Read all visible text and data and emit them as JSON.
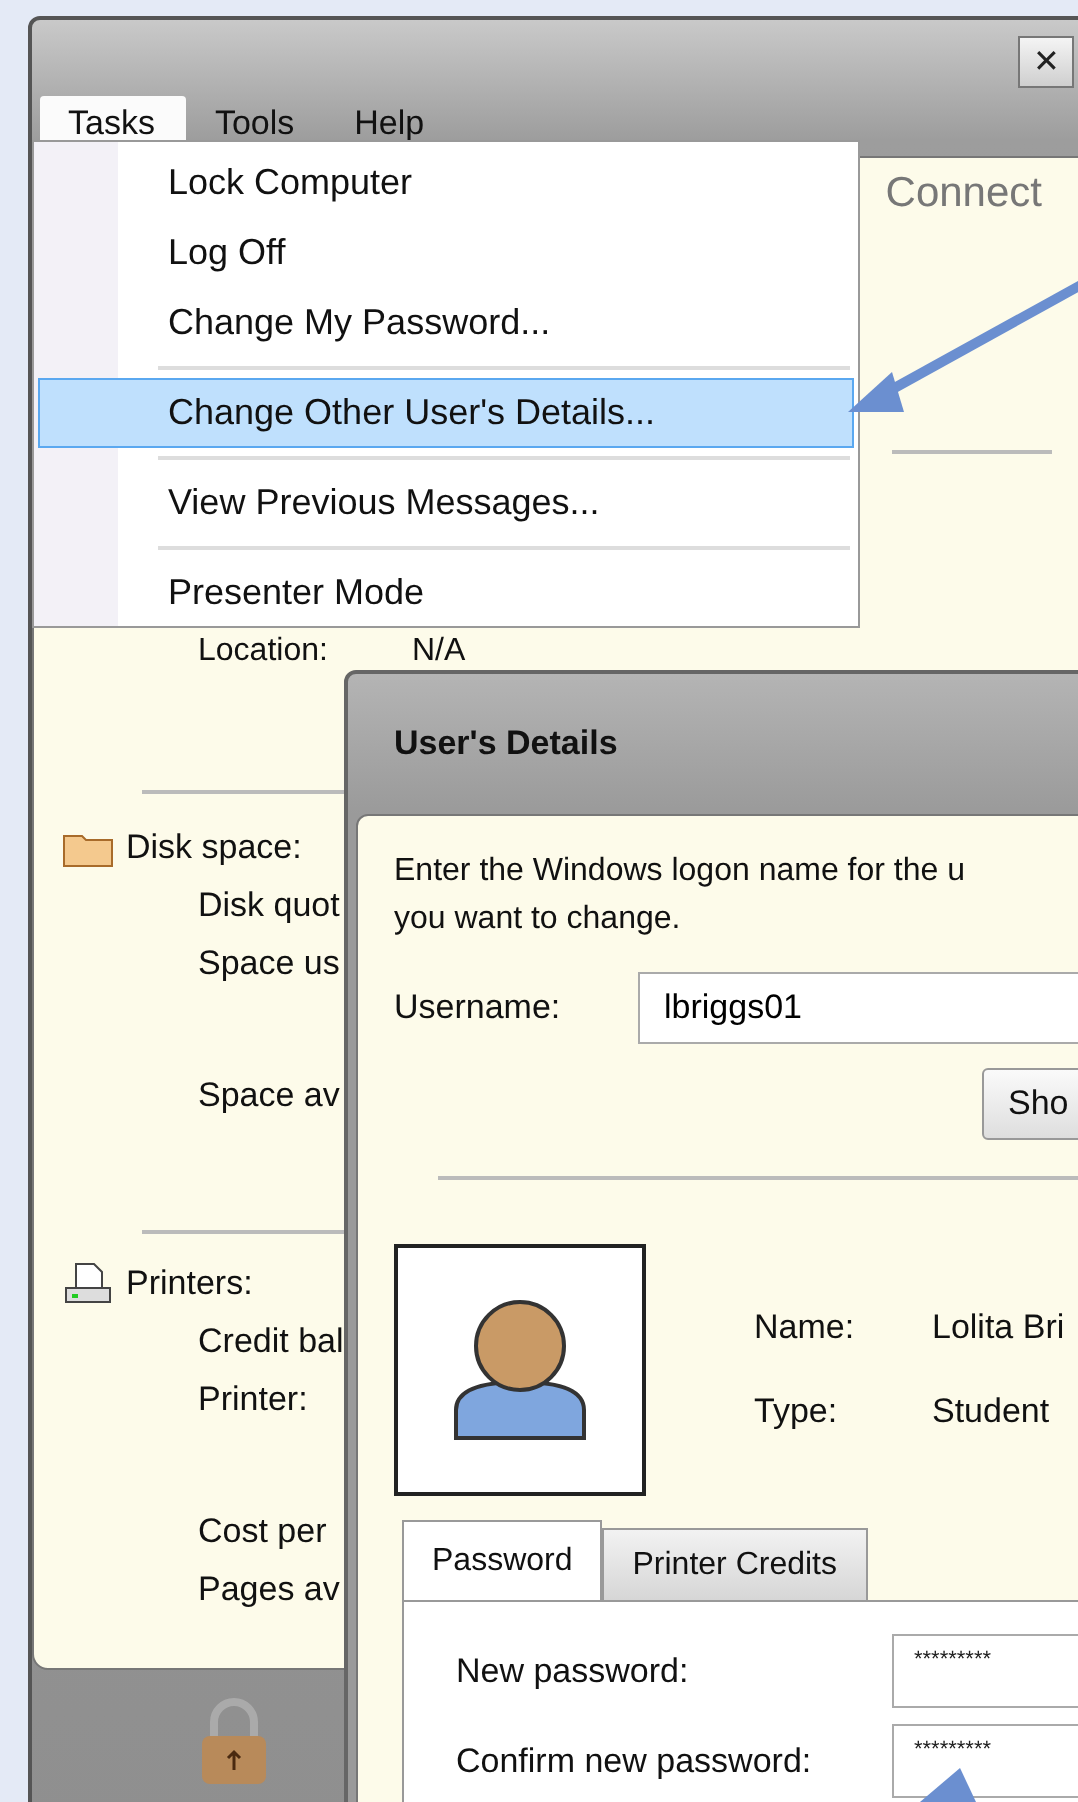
{
  "window": {
    "header": "Connect",
    "close": "✕"
  },
  "menubar": [
    {
      "label": "Tasks",
      "selected": true
    },
    {
      "label": "Tools",
      "selected": false
    },
    {
      "label": "Help",
      "selected": false
    }
  ],
  "menu": [
    {
      "kind": "item",
      "label": "Lock Computer",
      "selected": false
    },
    {
      "kind": "item",
      "label": "Log Off",
      "selected": false
    },
    {
      "kind": "item",
      "label": "Change My Password...",
      "selected": false
    },
    {
      "kind": "separator"
    },
    {
      "kind": "item",
      "label": "Change Other User's Details...",
      "selected": true
    },
    {
      "kind": "separator"
    },
    {
      "kind": "item",
      "label": "View Previous Messages...",
      "selected": false
    },
    {
      "kind": "separator"
    },
    {
      "kind": "item",
      "label": "Presenter Mode",
      "selected": false
    }
  ],
  "panel": {
    "location": {
      "label": "Location:",
      "value": "N/A"
    },
    "sections": [
      {
        "kind": "disk",
        "title": "Disk space:",
        "rows": [
          "Disk quot",
          "Space us",
          "Space av"
        ]
      },
      {
        "kind": "printer",
        "title": "Printers:",
        "rows": [
          "Credit bal",
          "Printer:",
          "Cost per",
          "Pages av"
        ]
      }
    ]
  },
  "dialog": {
    "title": "User's Details",
    "instructions": [
      "Enter the Windows logon name for the u",
      "you want to change."
    ],
    "username": {
      "label": "Username:",
      "value": "lbriggs01"
    },
    "show_button": "Sho",
    "user": [
      {
        "label": "Name:",
        "value": "Lolita Bri"
      },
      {
        "label": "Type:",
        "value": "Student"
      }
    ],
    "tabs": [
      {
        "label": "Password",
        "selected": true
      },
      {
        "label": "Printer Credits",
        "selected": false
      }
    ],
    "fields": [
      {
        "label": "New password:",
        "value": "*********"
      },
      {
        "label": "Confirm new password:",
        "value": "*********"
      }
    ]
  }
}
